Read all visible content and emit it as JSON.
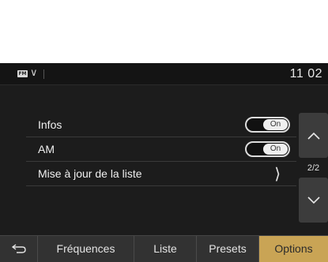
{
  "status": {
    "source_icon": "radio-source-icon",
    "source_text": "FM",
    "clock": "11 02"
  },
  "list": {
    "items": [
      {
        "label": "Infos",
        "type": "toggle",
        "toggle_label": "On"
      },
      {
        "label": "AM",
        "type": "toggle",
        "toggle_label": "On"
      },
      {
        "label": "Mise à jour de la liste",
        "type": "link"
      }
    ]
  },
  "scroll": {
    "page_indicator": "2/2",
    "up_icon": "chevron-up-icon",
    "down_icon": "chevron-down-icon"
  },
  "tabs": {
    "back_icon": "back-arrow-icon",
    "items": [
      "Fréquences",
      "Liste",
      "Presets",
      "Options"
    ],
    "active": "Options"
  },
  "colors": {
    "background": "#1c1c1c",
    "active_tab": "#c9a455",
    "button_gray": "#3c3c3c"
  }
}
